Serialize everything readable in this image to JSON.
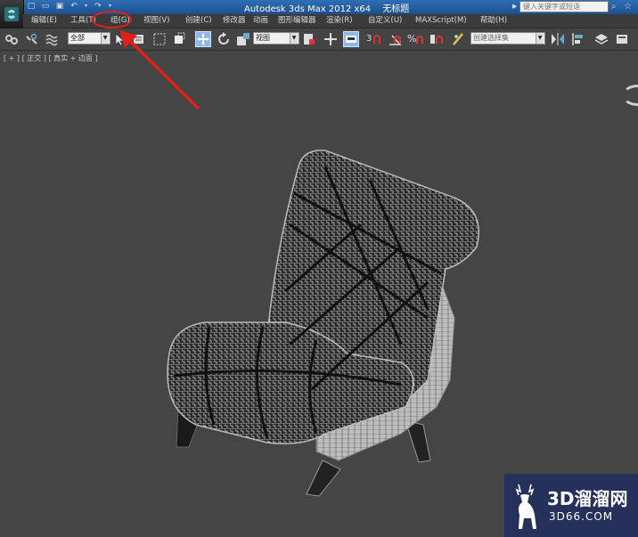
{
  "titlebar": {
    "app_name": "Autodesk 3ds Max  2012 x64",
    "file_name": "无标题",
    "search_placeholder": "键入关键字或短语"
  },
  "menu": {
    "edit": "编辑(E)",
    "tools": "工具(T)",
    "group": "组(G)",
    "views": "视图(V)",
    "create": "创建(C)",
    "modifiers": "修改器",
    "animation": "动画",
    "graph_editors": "图形编辑器",
    "rendering": "渲染(R)",
    "customize": "自定义(U)",
    "maxscript": "MAXScript(M)",
    "help": "帮助(H)"
  },
  "toolbar": {
    "selection_filter": "全部",
    "reference_coord": "视图",
    "named_selection_set": "创建选择集"
  },
  "viewport": {
    "label": "[ + ] [ 正交 ] [ 真实 + 边面 ]"
  },
  "annotation": {
    "highlight_color": "#e0201a",
    "highlight_target": "menu.group"
  },
  "watermark": {
    "brand": "3D溜溜网",
    "domain": "3D66.COM"
  }
}
